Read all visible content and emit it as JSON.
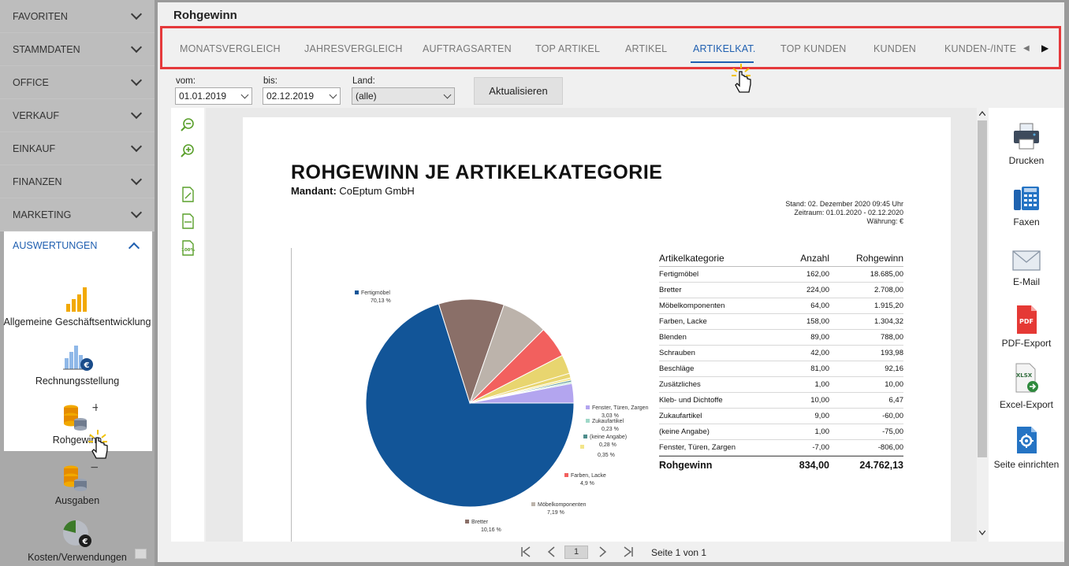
{
  "sidebar": {
    "items": [
      {
        "label": "FAVORITEN"
      },
      {
        "label": "STAMMDATEN"
      },
      {
        "label": "OFFICE"
      },
      {
        "label": "VERKAUF"
      },
      {
        "label": "EINKAUF"
      },
      {
        "label": "FINANZEN"
      },
      {
        "label": "MARKETING"
      }
    ],
    "active_section": "AUSWERTUNGEN",
    "tools": [
      {
        "label": "Allgemeine Geschäftsentwicklung",
        "icon": "bar-chart-icon"
      },
      {
        "label": "Rechnungsstellung",
        "icon": "invoice-chart-icon"
      },
      {
        "label": "Rohgewinn",
        "icon": "coins-plus-icon"
      },
      {
        "label": "Ausgaben",
        "icon": "coins-minus-icon"
      },
      {
        "label": "Kosten/Verwendungen",
        "icon": "pie-euro-icon"
      }
    ]
  },
  "header": {
    "title": "Rohgewinn"
  },
  "tabs": [
    {
      "label": "MONATSVERGLEICH"
    },
    {
      "label": "JAHRESVERGLEICH"
    },
    {
      "label": "AUFTRAGSARTEN"
    },
    {
      "label": "TOP ARTIKEL"
    },
    {
      "label": "ARTIKEL"
    },
    {
      "label": "ARTIKELKAT.",
      "active": true
    },
    {
      "label": "TOP KUNDEN"
    },
    {
      "label": "KUNDEN"
    },
    {
      "label": "KUNDEN-/INTE"
    }
  ],
  "filters": {
    "from_label": "vom:",
    "from_value": "01.01.2019",
    "to_label": "bis:",
    "to_value": "02.12.2019",
    "country_label": "Land:",
    "country_value": "(alle)",
    "refresh_label": "Aktualisieren"
  },
  "report": {
    "title": "ROHGEWINN JE ARTIKELKATEGORIE",
    "mandant_label": "Mandant:",
    "mandant_value": "CoEptum GmbH",
    "stand": "Stand:  02. Dezember 2020 09:45 Uhr",
    "zeitraum": "Zeitraum: 01.01.2020 - 02.12.2020",
    "waehrung": "Währung: €",
    "table": {
      "headers": [
        "Artikelkategorie",
        "Anzahl",
        "Rohgewinn"
      ],
      "rows": [
        [
          "Fertigmöbel",
          "162,00",
          "18.685,00"
        ],
        [
          "Bretter",
          "224,00",
          "2.708,00"
        ],
        [
          "Möbelkomponenten",
          "64,00",
          "1.915,20"
        ],
        [
          "Farben, Lacke",
          "158,00",
          "1.304,32"
        ],
        [
          "Blenden",
          "89,00",
          "788,00"
        ],
        [
          "Schrauben",
          "42,00",
          "193,98"
        ],
        [
          "Beschläge",
          "81,00",
          "92,16"
        ],
        [
          "Zusätzliches",
          "1,00",
          "10,00"
        ],
        [
          "Kleb- und Dichtoffe",
          "10,00",
          "6,47"
        ],
        [
          "Zukaufartikel",
          "9,00",
          "-60,00"
        ],
        [
          "(keine Angabe)",
          "1,00",
          "-75,00"
        ],
        [
          "Fenster, Türen, Zargen",
          "-7,00",
          "-806,00"
        ]
      ],
      "total": [
        "Rohgewinn",
        "834,00",
        "24.762,13"
      ]
    }
  },
  "chart_data": {
    "type": "pie",
    "slices": [
      {
        "name": "Fertigmöbel",
        "value": 70.13,
        "label": "70,13 %",
        "color": "#125598"
      },
      {
        "name": "Bretter",
        "value": 10.16,
        "label": "10,16 %",
        "color": "#8a6f68"
      },
      {
        "name": "Möbelkomponenten",
        "value": 7.19,
        "label": "7,19 %",
        "color": "#bcb3ab"
      },
      {
        "name": "Farben, Lacke",
        "value": 4.9,
        "label": "4,9 %",
        "color": "#f2605e"
      },
      {
        "name": "",
        "value": 2.96,
        "label": "",
        "color": "#e8d56f"
      },
      {
        "name": "",
        "value": 0.73,
        "label": "",
        "color": "#e8d56f"
      },
      {
        "name": "",
        "value": 0.35,
        "label": "0,35 %",
        "color": "#f3e58a"
      },
      {
        "name": "(keine Angabe)",
        "value": 0.28,
        "label": "0,28 %",
        "color": "#4e8d8c"
      },
      {
        "name": "Zukaufartikel",
        "value": 0.23,
        "label": "0,23 %",
        "color": "#9fd8c8"
      },
      {
        "name": "Fenster, Türen, Zargen",
        "value": 3.03,
        "label": "3,03 %",
        "color": "#b3a5ef"
      }
    ]
  },
  "actions": [
    {
      "label": "Drucken",
      "icon": "printer-icon"
    },
    {
      "label": "Faxen",
      "icon": "fax-icon"
    },
    {
      "label": "E-Mail",
      "icon": "mail-icon"
    },
    {
      "label": "PDF-Export",
      "icon": "pdf-icon"
    },
    {
      "label": "Excel-Export",
      "icon": "xlsx-icon"
    },
    {
      "label": "Seite einrichten",
      "icon": "page-setup-icon"
    }
  ],
  "pager": {
    "page": "1",
    "info": "Seite 1 von 1"
  }
}
